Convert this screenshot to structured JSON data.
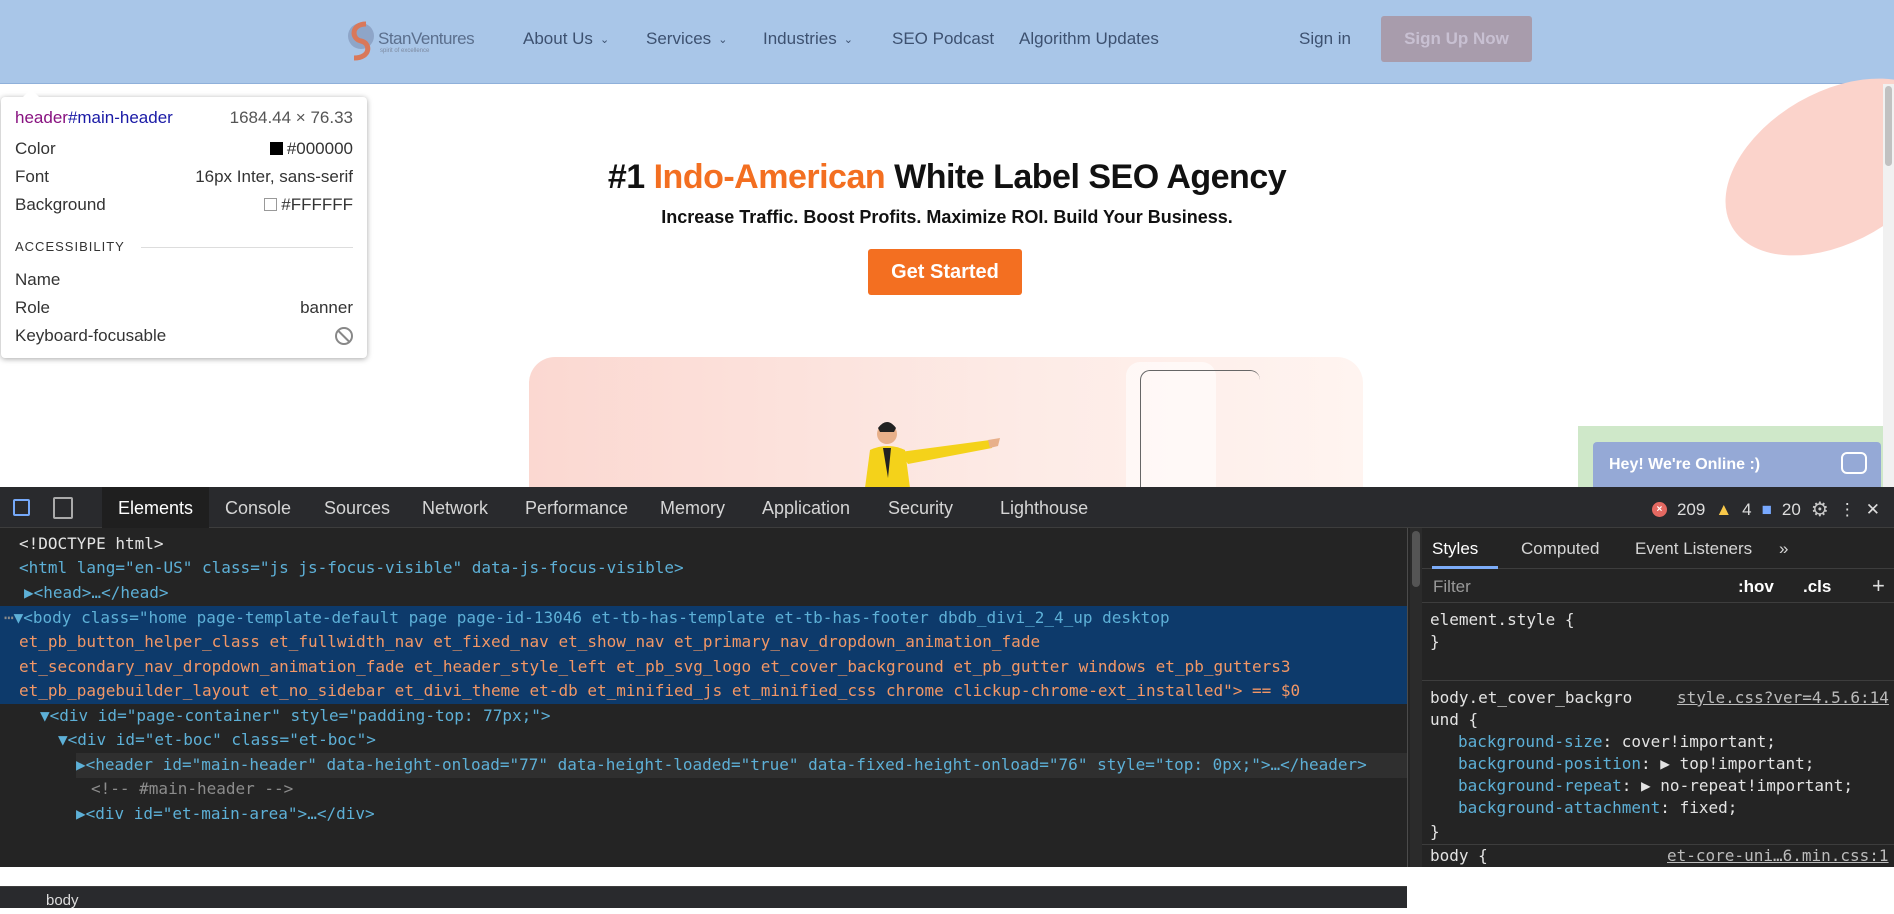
{
  "site": {
    "logo": {
      "name": "StanVentures",
      "tagline": "spirit of excellence"
    },
    "nav": [
      {
        "label": "About Us",
        "dropdown": true
      },
      {
        "label": "Services",
        "dropdown": true
      },
      {
        "label": "Industries",
        "dropdown": true
      },
      {
        "label": "SEO Podcast",
        "dropdown": false
      },
      {
        "label": "Algorithm Updates",
        "dropdown": false
      }
    ],
    "sign_in": "Sign in",
    "sign_up": "Sign Up Now",
    "hero": {
      "title_prefix": "#1 ",
      "title_accent": "Indo-American",
      "title_suffix": " White Label SEO Agency",
      "subtitle": "Increase Traffic. Boost Profits. Maximize ROI. Build Your Business.",
      "cta": "Get Started"
    },
    "chat_widget": "Hey! We're Online :)"
  },
  "tooltip": {
    "selector_tag": "header",
    "selector_id": "#main-header",
    "dimensions": "1684.44 × 76.33",
    "rows": [
      {
        "label": "Color",
        "value": "#000000"
      },
      {
        "label": "Font",
        "value": "16px Inter, sans-serif"
      },
      {
        "label": "Background",
        "value": "#FFFFFF"
      }
    ],
    "section": "ACCESSIBILITY",
    "a11y": [
      {
        "label": "Name",
        "value": ""
      },
      {
        "label": "Role",
        "value": "banner"
      },
      {
        "label": "Keyboard-focusable",
        "value": ""
      }
    ]
  },
  "devtools": {
    "tabs": [
      "Elements",
      "Console",
      "Sources",
      "Network",
      "Performance",
      "Memory",
      "Application",
      "Security",
      "Lighthouse"
    ],
    "active_tab": "Elements",
    "errors": "209",
    "warnings": "4",
    "infos": "20",
    "dom_lines": [
      "<!DOCTYPE html>",
      "<html lang=\"en-US\" class=\"js js-focus-visible\" data-js-focus-visible>",
      "▶<head>…</head>",
      "▼<body class=\"home page-template-default page page-id-13046 et-tb-has-template et-tb-has-footer dbdb_divi_2_4_up desktop",
      "et_pb_button_helper_class et_fullwidth_nav et_fixed_nav et_show_nav et_primary_nav_dropdown_animation_fade",
      "et_secondary_nav_dropdown_animation_fade et_header_style_left et_pb_svg_logo et_cover_background et_pb_gutter windows et_pb_gutters3",
      "et_pb_pagebuilder_layout et_no_sidebar et_divi_theme et-db et_minified_js et_minified_css chrome clickup-chrome-ext_installed\"> == $0",
      "▼<div id=\"page-container\" style=\"padding-top: 77px;\">",
      "▼<div id=\"et-boc\" class=\"et-boc\">",
      "▶<header id=\"main-header\" data-height-onload=\"77\" data-height-loaded=\"true\" data-fixed-height-onload=\"76\" style=\"top: 0px;\">…</header>",
      "<!-- #main-header -->",
      "▶<div id=\"et-main-area\">…</div>"
    ],
    "breadcrumb": "body",
    "styles": {
      "tabs": [
        "Styles",
        "Computed",
        "Event Listeners"
      ],
      "more": "»",
      "filter_placeholder": "Filter",
      "hov": ":hov",
      "cls": ".cls",
      "plus": "+",
      "element_style_open": "element.style {",
      "element_style_close": "}",
      "rule1_selector_a": "body.et_cover_backgro",
      "rule1_selector_b": "und {",
      "rule1_source": "style.css?ver=4.5.6:14",
      "rule1_props": [
        {
          "prop": "background-size",
          "value": "cover!important;"
        },
        {
          "prop": "background-position",
          "value": "▶ top!important;"
        },
        {
          "prop": "background-repeat",
          "value": "▶ no-repeat!important;"
        },
        {
          "prop": "background-attachment",
          "value": "fixed;"
        }
      ],
      "rule1_close": "}",
      "rule2_selector": "body {",
      "rule2_source": "et-core-uni…6.min.css:1"
    }
  },
  "colors": {
    "accent": "#f36f21",
    "header_bg": "#a9c6e8",
    "devtools_bg": "#242424",
    "selection": "#0d3a6b"
  }
}
